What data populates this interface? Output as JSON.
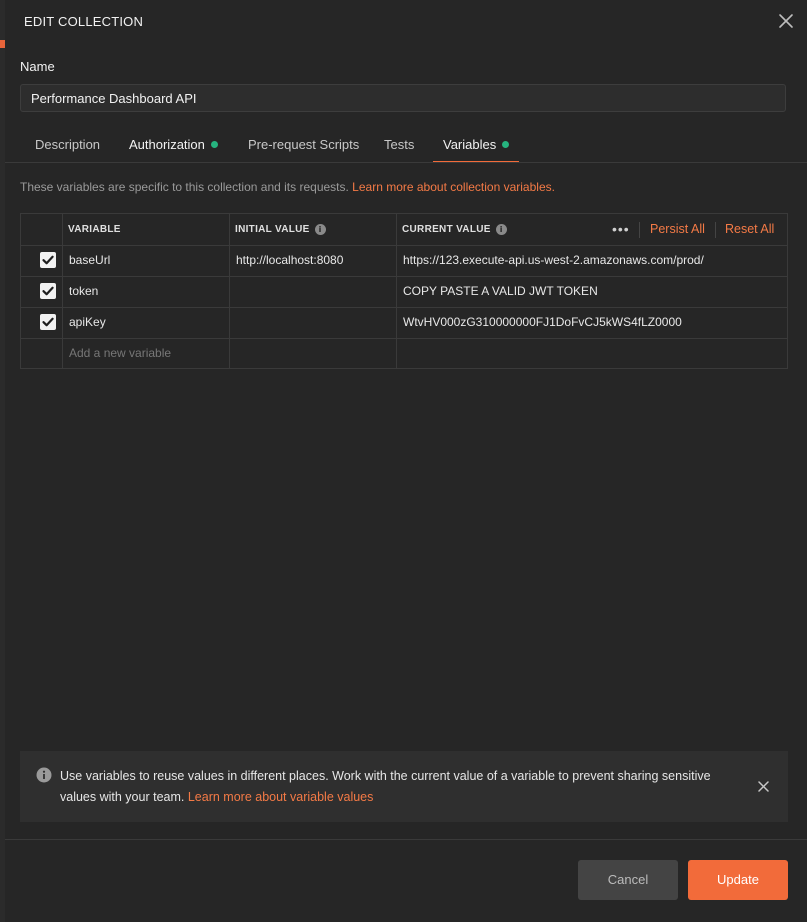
{
  "dialog": {
    "title": "EDIT COLLECTION"
  },
  "name": {
    "label": "Name",
    "value": "Performance Dashboard API"
  },
  "tabs": [
    {
      "label": "Description"
    },
    {
      "label": "Authorization"
    },
    {
      "label": "Pre-request Scripts"
    },
    {
      "label": "Tests"
    },
    {
      "label": "Variables"
    }
  ],
  "variables": {
    "description": "These variables are specific to this collection and its requests.",
    "learn_more": "Learn more about collection variables.",
    "headers": {
      "variable": "VARIABLE",
      "initial": "INITIAL VALUE",
      "current": "CURRENT VALUE"
    },
    "more_label": "•••",
    "persist_all": "Persist All",
    "reset_all": "Reset All",
    "rows": [
      {
        "name": "baseUrl",
        "initial": "http://localhost:8080",
        "current": "https://123.execute-api.us-west-2.amazonaws.com/prod/"
      },
      {
        "name": "token",
        "initial": "",
        "current": "COPY PASTE A VALID JWT TOKEN"
      },
      {
        "name": "apiKey",
        "initial": "",
        "current": "WtvHV000zG310000000FJ1DoFvCJ5kWS4fLZ0000"
      }
    ],
    "add_placeholder": "Add a new variable"
  },
  "banner": {
    "text": "Use variables to reuse values in different places. Work with the current value of a variable to prevent sharing sensitive values with your team.",
    "link": "Learn more about variable values"
  },
  "footer": {
    "cancel": "Cancel",
    "update": "Update"
  },
  "colors": {
    "accent": "#f26b3a",
    "status_dot": "#26b47f"
  }
}
